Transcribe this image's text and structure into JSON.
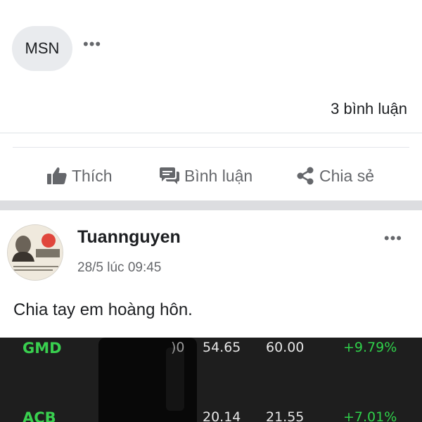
{
  "header": {
    "source_chip": "MSN",
    "more_label": "•••"
  },
  "stats": {
    "comment_count": "3 bình luận"
  },
  "actions": {
    "like": "Thích",
    "comment": "Bình luận",
    "share": "Chia sẻ"
  },
  "post": {
    "author": "Tuannguyen",
    "timestamp": "28/5 lúc 09:45",
    "more_label": "•••",
    "text": "Chia tay em hoàng hôn."
  },
  "stock_table": {
    "rows": [
      {
        "symbol": "GMD",
        "partial": ")0",
        "price1": "54.65",
        "price2": "60.00",
        "change": "+9.79%"
      },
      {
        "symbol": "ACB",
        "partial": "",
        "price1": "20.14",
        "price2": "21.55",
        "change": "+7.01%"
      }
    ]
  },
  "colors": {
    "action_gray": "#65676b",
    "stock_green": "#2fd04a",
    "image_bg": "#1e1e1e"
  }
}
